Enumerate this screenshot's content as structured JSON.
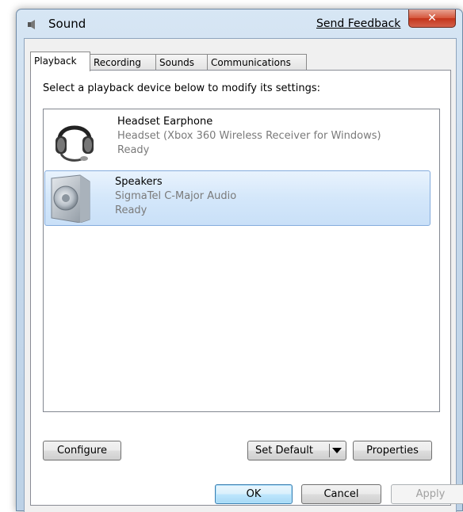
{
  "window": {
    "title": "Sound",
    "send_feedback": "Send Feedback",
    "close_glyph": "✕",
    "title_icon": "speaker-icon"
  },
  "tabs": [
    {
      "label": "Playback",
      "active": true
    },
    {
      "label": "Recording",
      "active": false
    },
    {
      "label": "Sounds",
      "active": false
    },
    {
      "label": "Communications",
      "active": false
    }
  ],
  "playback": {
    "instruction": "Select a playback device below to modify its settings:",
    "devices": [
      {
        "name": "Headset Earphone",
        "description": "Headset (Xbox 360 Wireless Receiver for Windows)",
        "status": "Ready",
        "icon": "headset-icon",
        "selected": false
      },
      {
        "name": "Speakers",
        "description": "SigmaTel C-Major Audio",
        "status": "Ready",
        "icon": "speaker-icon",
        "selected": true
      }
    ],
    "buttons": {
      "configure": "Configure",
      "set_default": "Set Default",
      "properties": "Properties"
    }
  },
  "dialog_buttons": {
    "ok": "OK",
    "cancel": "Cancel",
    "apply": "Apply"
  },
  "colors": {
    "selection": "#cde4f9",
    "close_button": "#c4351b",
    "frame": "#c6d9ec"
  }
}
